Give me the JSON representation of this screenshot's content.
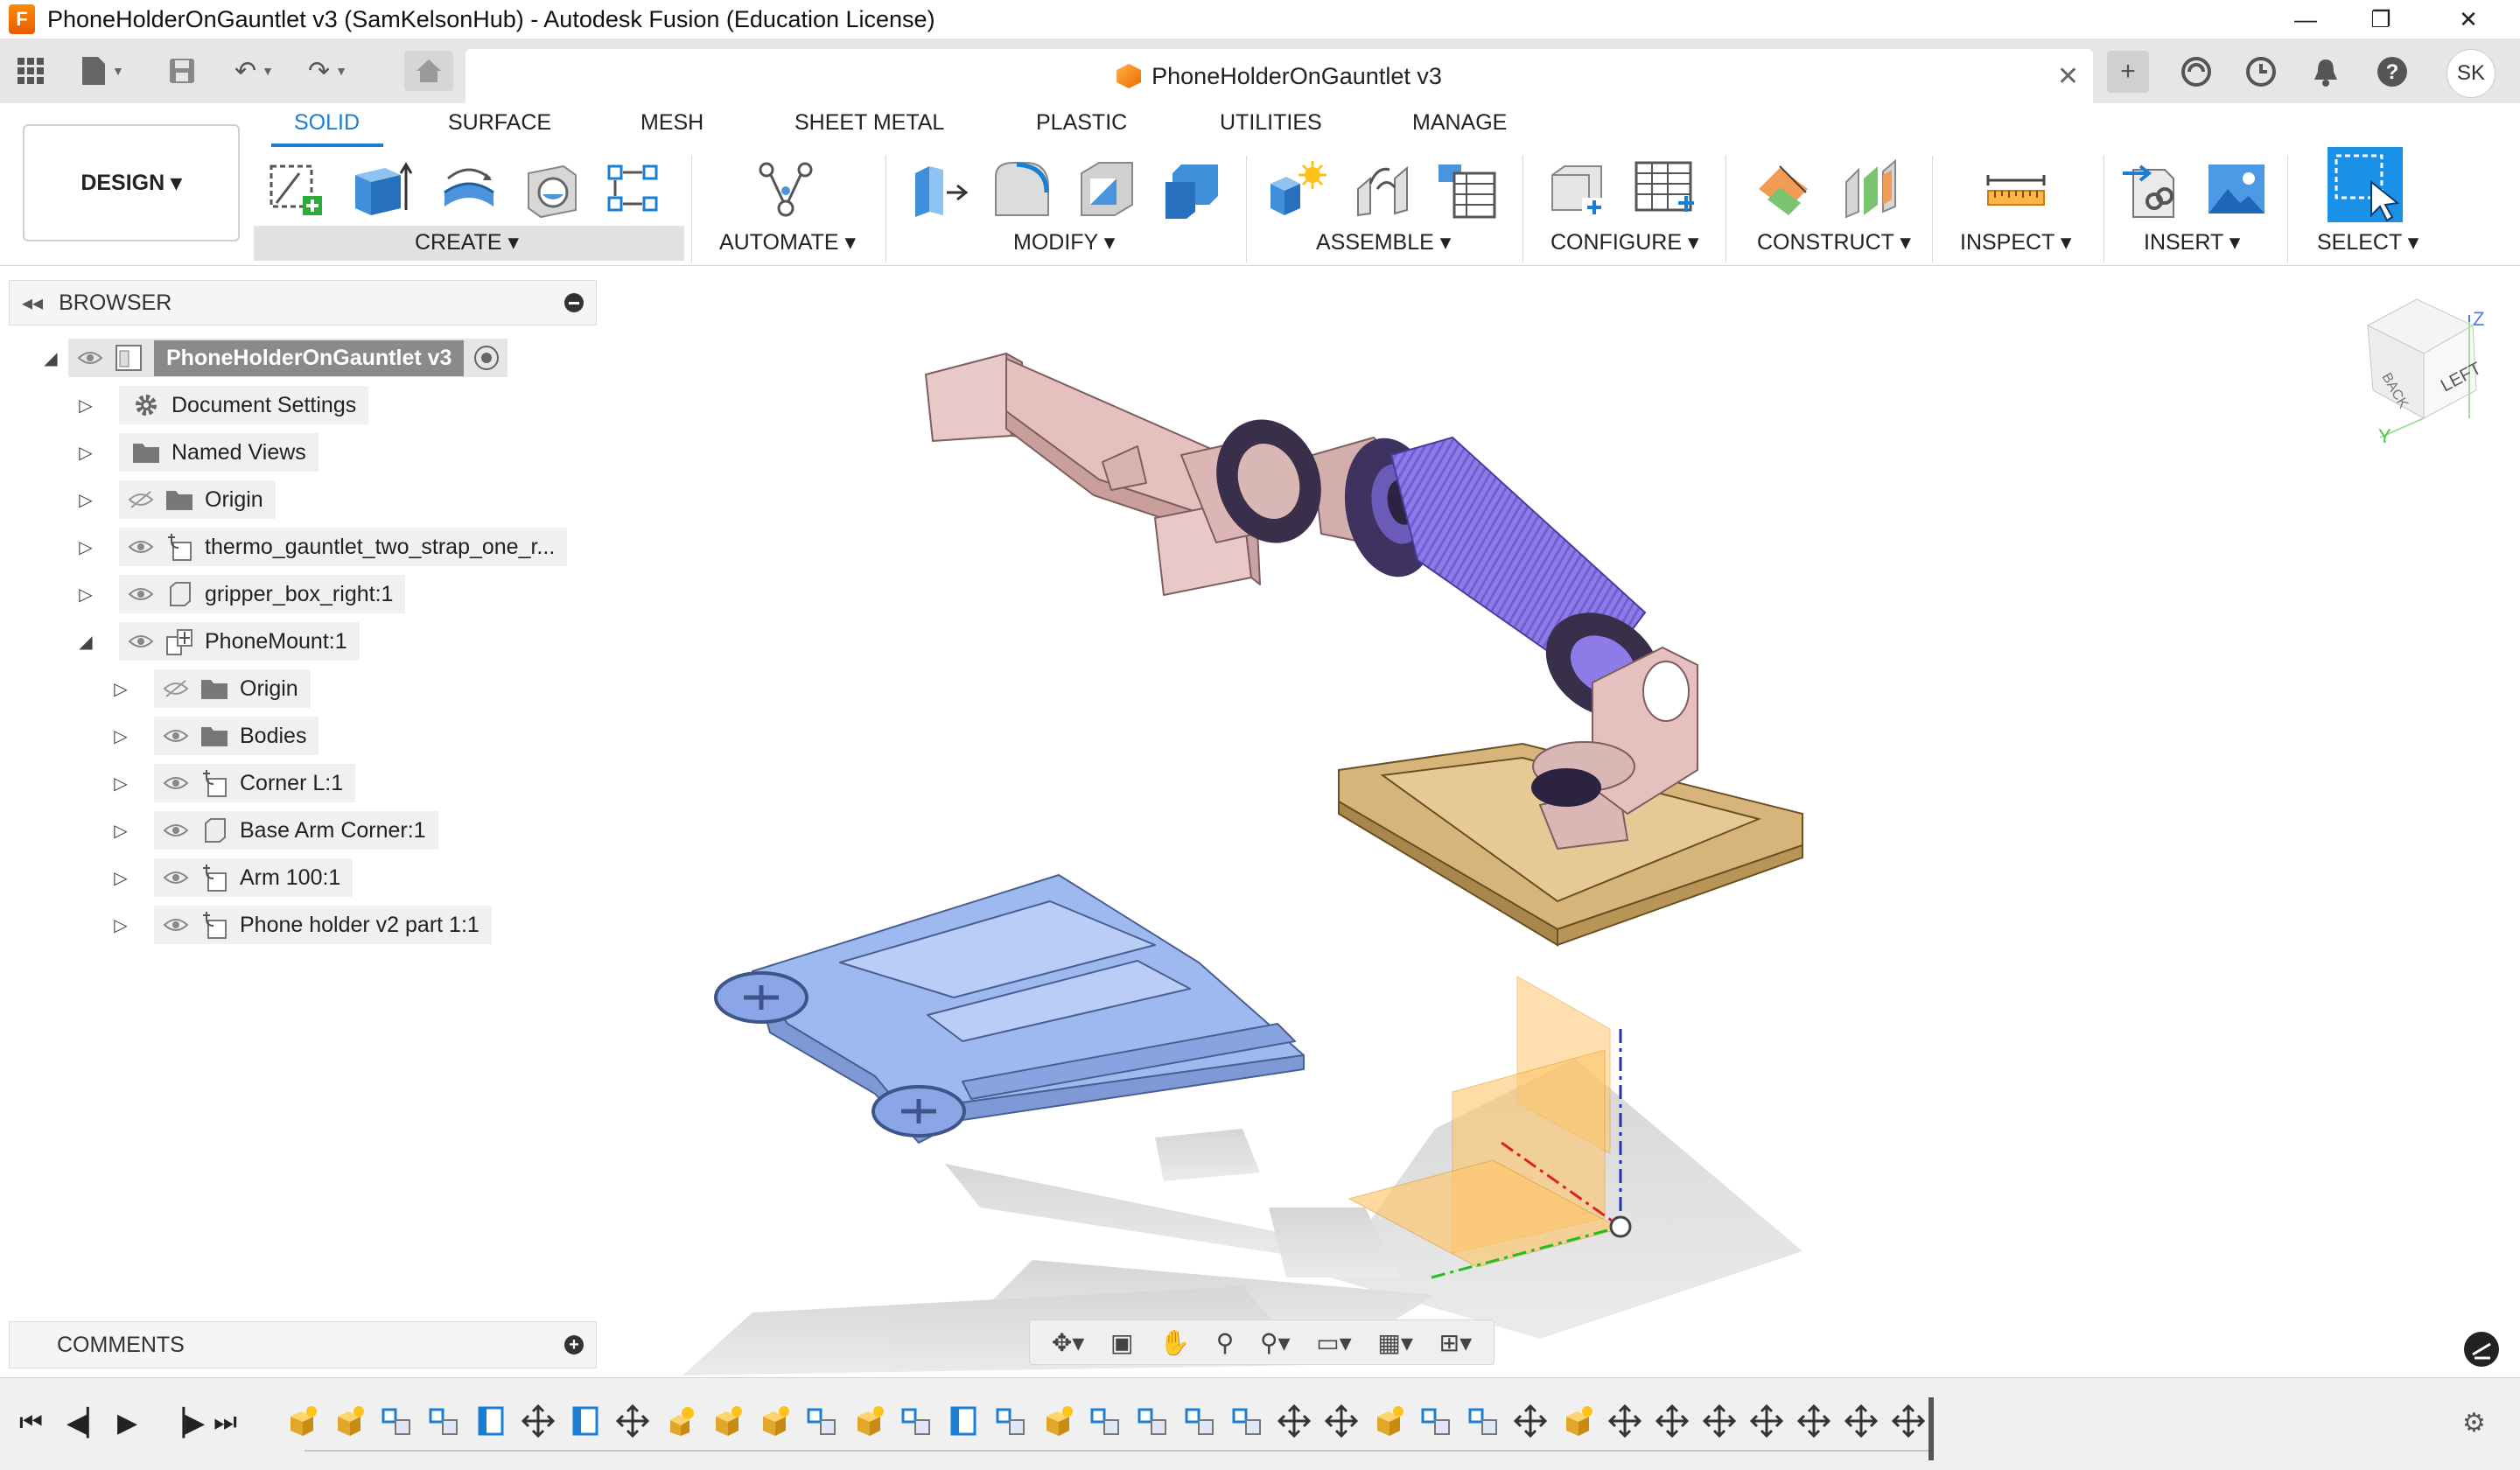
{
  "window": {
    "title": "PhoneHolderOnGauntlet v3 (SamKelsonHub) - Autodesk Fusion (Education License)",
    "app_icon_text": "F",
    "controls": [
      "minimize",
      "restore",
      "close"
    ]
  },
  "quick_access": {
    "doc_tab_title": "PhoneHolderOnGauntlet v3",
    "user_initials": "SK"
  },
  "ribbon": {
    "workspace_button": "DESIGN ▾",
    "tabs": [
      "SOLID",
      "SURFACE",
      "MESH",
      "SHEET METAL",
      "PLASTIC",
      "UTILITIES",
      "MANAGE"
    ],
    "active_tab": "SOLID",
    "groups": [
      "CREATE ▾",
      "AUTOMATE ▾",
      "MODIFY ▾",
      "ASSEMBLE ▾",
      "CONFIGURE ▾",
      "CONSTRUCT ▾",
      "INSPECT ▾",
      "INSERT ▾",
      "SELECT ▾"
    ],
    "accent_color": "#1a7fd4"
  },
  "browser": {
    "title": "BROWSER",
    "root": "PhoneHolderOnGauntlet v3",
    "items": [
      {
        "label": "Document Settings"
      },
      {
        "label": "Named Views"
      },
      {
        "label": "Origin"
      },
      {
        "label": "thermo_gauntlet_two_strap_one_r..."
      },
      {
        "label": "gripper_box_right:1"
      },
      {
        "label": "PhoneMount:1"
      },
      {
        "label": "Origin"
      },
      {
        "label": "Bodies"
      },
      {
        "label": "Corner L:1"
      },
      {
        "label": "Base Arm Corner:1"
      },
      {
        "label": "Arm 100:1"
      },
      {
        "label": "Phone holder v2 part 1:1"
      }
    ]
  },
  "comments": {
    "title": "COMMENTS"
  },
  "viewcube": {
    "face_left": "LEFT",
    "face_back": "BACK",
    "axis_z": "Z",
    "axis_y": "Y"
  },
  "colors": {
    "ribbon_accent": "#1a7fd4",
    "model_pink": "#e8c8c6",
    "model_purple": "#8d7ce8",
    "model_blue": "#9eb8f0",
    "model_tan": "#d8b77c",
    "origin_plane": "#ffc66b"
  }
}
